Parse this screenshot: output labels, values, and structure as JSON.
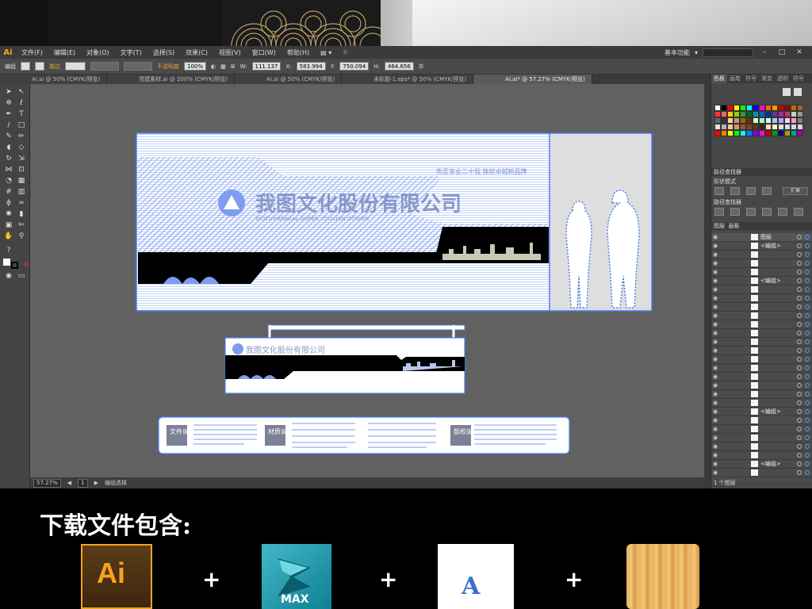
{
  "menubar": {
    "app_logo": "Ai",
    "items": [
      "文件(F)",
      "编辑(E)",
      "对象(O)",
      "文字(T)",
      "选择(S)",
      "效果(C)",
      "视图(V)",
      "窗口(W)",
      "帮助(H)"
    ],
    "workspace": "基本功能"
  },
  "controlbar": {
    "mode": "编组",
    "stroke_label": "描边",
    "opacity_label": "不透明度",
    "opacity_value": "100%",
    "w_value": "111.137",
    "x_value": "583.994",
    "y_value": "750.094",
    "h_value": "464.656"
  },
  "tabs": [
    "AI.ai @ 50% (CMYK/预览)",
    "党建素材.ai @ 200% (CMYK/预览)",
    "AI.ai @ 50% (CMYK/预览)",
    "未标题-1.eps* @ 50% (CMYK/预览)",
    "AI.ai* @ 57.27% (CMYK/预览)"
  ],
  "active_tab": 4,
  "canvas": {
    "company_name": "我图文化股份有限公司",
    "company_en": "WOTUWENHUA GUFEN YOUXIAN GONGSI",
    "slogan": "热爱事业二十载 铸就卓越新品牌",
    "legend": [
      {
        "title": "文件说明"
      },
      {
        "title": "材质说明"
      },
      {
        "title": "版权说明"
      }
    ]
  },
  "status": {
    "zoom": "57.27%",
    "page": "1",
    "mode": "编组选择"
  },
  "panels": {
    "tabs": [
      "色板",
      "画笔",
      "符号",
      "渐变",
      "透明",
      "符号"
    ],
    "pathfinder": "路径查找器",
    "shape_modes": "形状模式",
    "pathfinders": "路径查找器",
    "expand": "扩展",
    "layers_tabs": [
      "图层",
      "画板"
    ],
    "layers": [
      {
        "name": "图层",
        "level": 0
      },
      {
        "name": "<编组>",
        "level": 1
      },
      {
        "name": "<编组>",
        "level": 1
      },
      {
        "name": "<编组>",
        "level": 1
      },
      {
        "name": "<编组>",
        "level": 1
      }
    ],
    "layer_count": "1 个图层"
  },
  "swatch_colors": [
    "#ffffff",
    "#000000",
    "#ff0000",
    "#ffff00",
    "#00ff00",
    "#00ffff",
    "#0000ff",
    "#ff00ff",
    "#ff6600",
    "#ff9900",
    "#cc0000",
    "#990000",
    "#cc6600",
    "#996633",
    "#ff3333",
    "#ff6666",
    "#ffcc00",
    "#99cc00",
    "#339933",
    "#006633",
    "#009999",
    "#0066cc",
    "#003399",
    "#663399",
    "#993399",
    "#cc3366",
    "#cccccc",
    "#999999",
    "#666666",
    "#333333",
    "#ffcc99",
    "#cc9966",
    "#996600",
    "#663300",
    "#ccffcc",
    "#99ffcc",
    "#ccffff",
    "#99ccff",
    "#cc99ff",
    "#ffccff",
    "#ff99cc",
    "#808080",
    "#e6e6e6",
    "#b3b3b3",
    "#f2c29c",
    "#d49a6a",
    "#a0522d",
    "#7a4a1a",
    "#5c3a1a",
    "#3d2614",
    "#ffe0b3",
    "#fff2cc",
    "#d9ead3",
    "#cfe2f3",
    "#d9d2e9",
    "#ead1dc",
    "#ff0000",
    "#ff8000",
    "#ffff00",
    "#00ff00",
    "#00ffff",
    "#0080ff",
    "#8000ff",
    "#ff00ff",
    "#c00000",
    "#00a000",
    "#0000a0",
    "#a0a000",
    "#00a0a0",
    "#a000a0"
  ],
  "download": {
    "title": "下载文件包含:",
    "plus": "+",
    "files": [
      {
        "label": "Ai",
        "icon": "illustrator-icon"
      },
      {
        "label": "MAX",
        "icon": "3dsmax-icon"
      },
      {
        "label": "A",
        "icon": "font-file-icon"
      },
      {
        "label": "",
        "icon": "wood-texture-icon"
      }
    ]
  }
}
